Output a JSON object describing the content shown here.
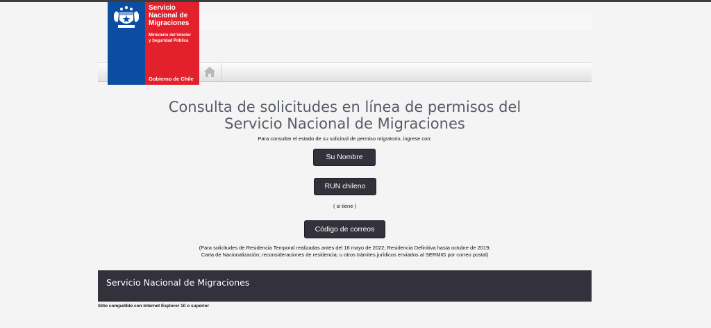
{
  "header": {
    "logo_title_lines": [
      "Servicio",
      "Nacional de",
      "Migraciones"
    ],
    "logo_ministry_lines": [
      "Ministerio del Interior",
      "y Seguridad Pública"
    ],
    "logo_gobierno": "Gobierno de Chile",
    "home_icon": "home-icon"
  },
  "main": {
    "title_line1": "Consulta de solicitudes en línea de permisos del",
    "title_line2": "Servicio Nacional de Migraciones",
    "subtitle": "Para consultar el estado de su solicitud de permiso migratorio, ingrese con:",
    "btn_nombre": "Su Nombre",
    "btn_run": "RUN chileno",
    "si_tiene": "( si tiene )",
    "btn_codigo": "Código de correos",
    "note_line1": "(Para solicitudes de Residencia Temporal realizadas antes del 16 mayo de 2022; Residencia Definitiva hasta octubre de 2019;",
    "note_line2": "Carta de Nacionalización; reconsideraciones de residencia; u otros trámites jurídicos enviados al SERMIG por correo postal)"
  },
  "footer": {
    "text": "Servicio Nacional de Migraciones",
    "compat": "Sitio compatible con Internet Explorer 10 o superior"
  },
  "colors": {
    "logo_blue": "#0c4da2",
    "logo_red": "#e3212d",
    "button_bg": "#32313c",
    "footer_bg": "#32313c",
    "title_text": "#575b66"
  }
}
